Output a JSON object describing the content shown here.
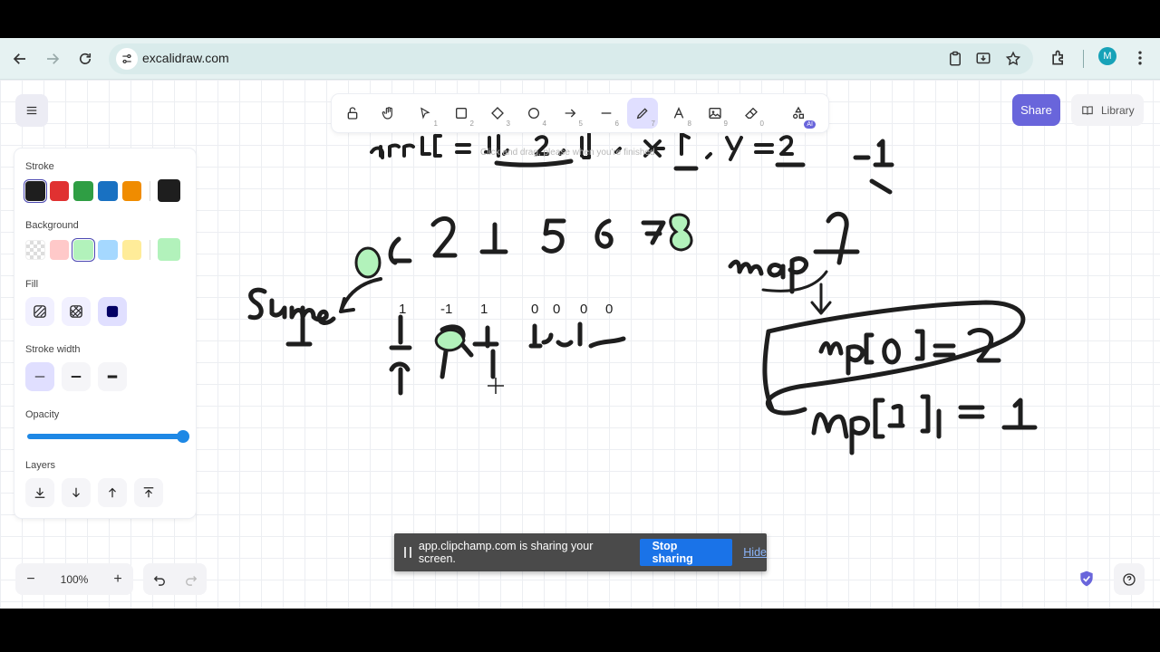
{
  "browser": {
    "url": "excalidraw.com",
    "profile_initial": "M"
  },
  "toolbar": {
    "tools": [
      {
        "name": "lock",
        "key": ""
      },
      {
        "name": "hand",
        "key": ""
      },
      {
        "name": "selection",
        "key": "1"
      },
      {
        "name": "rectangle",
        "key": "2"
      },
      {
        "name": "diamond",
        "key": "3"
      },
      {
        "name": "ellipse",
        "key": "4"
      },
      {
        "name": "arrow",
        "key": "5"
      },
      {
        "name": "line",
        "key": "6"
      },
      {
        "name": "draw",
        "key": "7"
      },
      {
        "name": "text",
        "key": "8"
      },
      {
        "name": "image",
        "key": "9"
      },
      {
        "name": "eraser",
        "key": "0"
      },
      {
        "name": "more-tools",
        "key": ""
      }
    ],
    "ai_badge": "AI",
    "hint": "Click and drag, please when you're finished"
  },
  "header": {
    "share_label": "Share",
    "library_label": "Library"
  },
  "properties": {
    "stroke_title": "Stroke",
    "background_title": "Background",
    "fill_title": "Fill",
    "stroke_width_title": "Stroke width",
    "opacity_title": "Opacity",
    "opacity_value": 100,
    "layers_title": "Layers",
    "stroke_colors": [
      "#1e1e1e",
      "#e03131",
      "#2f9e44",
      "#1971c2",
      "#f08c00"
    ],
    "stroke_current": "#1e1e1e",
    "background_colors": [
      "transparent",
      "#ffc9c9",
      "#b2f2bb",
      "#a5d8ff",
      "#ffec99"
    ],
    "background_current": "#b2f2bb"
  },
  "footer": {
    "zoom_out": "−",
    "zoom_value": "100%",
    "zoom_in": "+"
  },
  "share_banner": {
    "message": "app.clipchamp.com is sharing your screen.",
    "stop_label": "Stop sharing",
    "hide_label": "Hide"
  }
}
